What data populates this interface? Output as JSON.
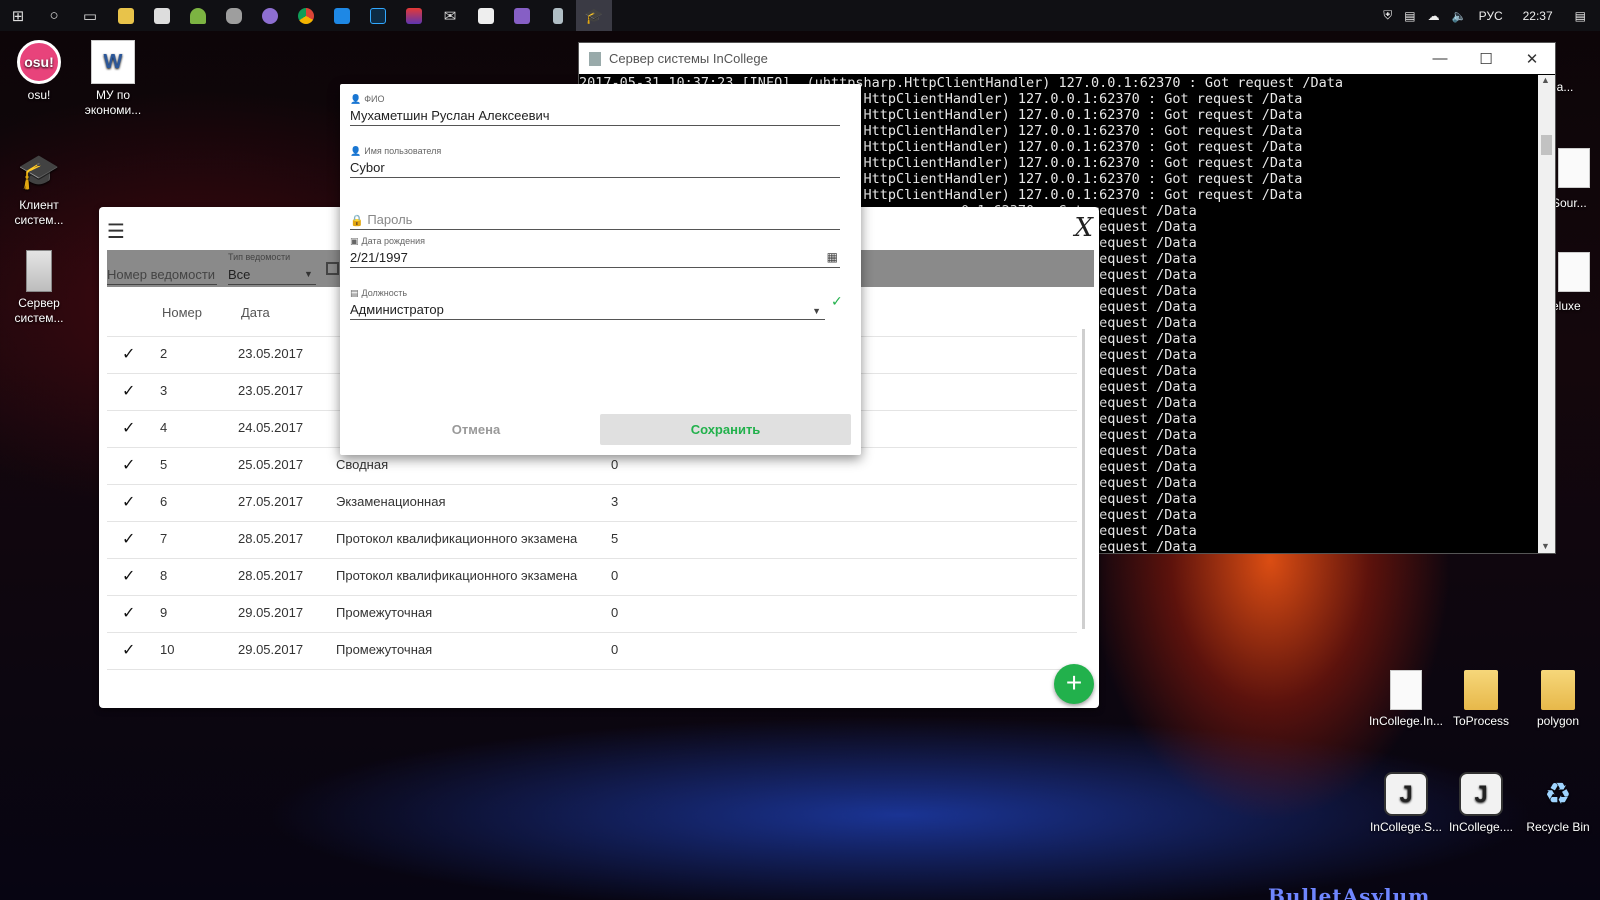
{
  "taskbar": {
    "lang": "РУС",
    "time": "22:37",
    "icons": [
      "windows-start-icon",
      "search-circle-icon",
      "task-view-icon",
      "explorer-icon",
      "store-icon",
      "android-icon",
      "database-icon",
      "browser-icon",
      "chrome-icon",
      "app-icon",
      "photoshop-icon",
      "media-icon",
      "mail-icon",
      "photos-icon",
      "visual-studio-icon",
      "phone-icon",
      "incollege-icon"
    ]
  },
  "desktop": {
    "left_icons": [
      {
        "label": "osu!"
      },
      {
        "label": "МУ по экономи..."
      },
      {
        "label": "Клиент систем..."
      },
      {
        "label": "Сервер систем..."
      }
    ],
    "right_edge": [
      {
        "label": "eStrea..."
      },
      {
        "label": "-Sour..."
      },
      {
        "label": "eluxe"
      }
    ],
    "right_icons": [
      {
        "label": "InCollege.In..."
      },
      {
        "label": "ToProcess"
      },
      {
        "label": "polygon"
      },
      {
        "label": "InCollege.S..."
      },
      {
        "label": "InCollege...."
      },
      {
        "label": "Recycle Bin"
      }
    ],
    "wallpaper_text": "BulletAsylum"
  },
  "console": {
    "title": "Сервер системы InCollege",
    "minimize": "—",
    "maximize": "☐",
    "close": "✕",
    "lines": [
      "2017-05-31 10:37:23 [INFO]  (uhttpsharp.HttpClientHandler) 127.0.0.1:62370 : Got request /Data",
      "                              harp.HttpClientHandler) 127.0.0.1:62370 : Got request /Data",
      "                              harp.HttpClientHandler) 127.0.0.1:62370 : Got request /Data",
      "                              harp.HttpClientHandler) 127.0.0.1:62370 : Got request /Data",
      "                              harp.HttpClientHandler) 127.0.0.1:62370 : Got request /Data",
      "                              harp.HttpClientHandler) 127.0.0.1:62370 : Got request /Data",
      "                              harp.HttpClientHandler) 127.0.0.1:62370 : Got request /Data",
      "                              harp.HttpClientHandler) 127.0.0.1:62370 : Got request /Data",
      "                                               0.1:62370 : Got request /Data",
      "                                               0.1:62370 : Got request /Data",
      "                                               0.1:62370 : Got request /Data",
      "                                               0.1:62370 : Got request /Data",
      "                                               0.1:62370 : Got request /Data",
      "                                               0.1:62370 : Got request /Data",
      "                                               0.1:62370 : Got request /Data",
      "                                               0.1:62370 : Got request /Data",
      "                                               0.1:62370 : Got request /Data",
      "                                               0.1:62370 : Got request /Data",
      "                                               0.1:62370 : Got request /Data",
      "                                               0.1:62370 : Got request /Data",
      "                                               0.1:62370 : Got request /Data",
      "                                               0.1:62370 : Got request /Data",
      "                                               0.1:62370 : Got request /Data",
      "                                               0.1:62370 : Got request /Data",
      "                                               0.1:62370 : Got request /Data",
      "                                               0.1:62370 : Got request /Data",
      "                                               0.1:62370 : Got request /Data",
      "                                               0.1:62370 : Got request /Data",
      "                                               0.1:62370 : Got request /Data",
      "                                               0.1:62370 : Got request /Data"
    ]
  },
  "app": {
    "menu_icon": "☰",
    "close_icon": "X",
    "filter": {
      "number_placeholder": "Номер ведомости",
      "type_label": "Тип ведомости",
      "type_value": "Все"
    },
    "columns": {
      "number": "Номер",
      "date": "Дата"
    },
    "rows": [
      {
        "check": "✓",
        "number": "2",
        "date": "23.05.2017",
        "type": "",
        "count": ""
      },
      {
        "check": "✓",
        "number": "3",
        "date": "23.05.2017",
        "type": "",
        "count": ""
      },
      {
        "check": "✓",
        "number": "4",
        "date": "24.05.2017",
        "type": "",
        "count": ""
      },
      {
        "check": "✓",
        "number": "5",
        "date": "25.05.2017",
        "type": "Сводная",
        "count": "0"
      },
      {
        "check": "✓",
        "number": "6",
        "date": "27.05.2017",
        "type": "Экзаменационная",
        "count": "3"
      },
      {
        "check": "✓",
        "number": "7",
        "date": "28.05.2017",
        "type": "Протокол квалификационного экзамена",
        "count": "5"
      },
      {
        "check": "✓",
        "number": "8",
        "date": "28.05.2017",
        "type": "Протокол квалификационного экзамена",
        "count": "0"
      },
      {
        "check": "✓",
        "number": "9",
        "date": "29.05.2017",
        "type": "Промежуточная",
        "count": "0"
      },
      {
        "check": "✓",
        "number": "10",
        "date": "29.05.2017",
        "type": "Промежуточная",
        "count": "0"
      }
    ],
    "add_button": "+"
  },
  "dialog": {
    "fio": {
      "label": "ФИО",
      "value": "Мухаметшин Руслан Алексеевич"
    },
    "username": {
      "label": "Имя пользователя",
      "value": "Cybor"
    },
    "password": {
      "placeholder": "Пароль"
    },
    "birthdate": {
      "label": "Дата рождения",
      "value": "2/21/1997"
    },
    "position": {
      "label": "Должность",
      "value": "Администратор"
    },
    "cancel": "Отмена",
    "save": "Сохранить"
  }
}
